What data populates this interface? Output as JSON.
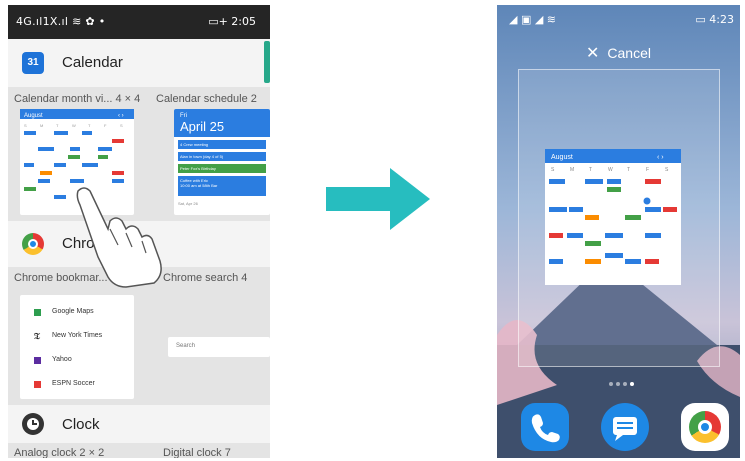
{
  "left_phone": {
    "status_bar": {
      "left": "4G.ıl1X.ıl ≋ ✿ •",
      "right": "▭+ 2:05"
    },
    "apps": [
      {
        "name": "Calendar",
        "icon": "calendar-icon",
        "icon_text": "31"
      },
      {
        "name": "Chrome",
        "icon": "chrome-icon"
      },
      {
        "name": "Clock",
        "icon": "clock-icon"
      }
    ],
    "calendar_widgets": [
      {
        "label": "Calendar month vi... 4 × 4"
      },
      {
        "label": "Calendar schedule  2"
      }
    ],
    "calendar_month_widget": {
      "month": "August"
    },
    "calendar_schedule_widget": {
      "day": "Fri",
      "date": "April 25",
      "events": [
        "4 Crew meeting",
        "Alan in town (day 4 of 5)",
        "Peter Fox's Birthday",
        "Coffee with Eric"
      ],
      "event_time": "10:00 am at 58th Bar",
      "footer": "Sat, Apr 26"
    },
    "chrome_widgets": [
      {
        "label": "Chrome bookmar... 3"
      },
      {
        "label": "Chrome search   4"
      }
    ],
    "bookmarks": [
      {
        "name": "Google Maps",
        "color": "#2e9e4f"
      },
      {
        "name": "New York Times",
        "color": "#222222"
      },
      {
        "name": "Yahoo",
        "color": "#5b2ca0"
      },
      {
        "name": "ESPN Soccer",
        "color": "#e53935"
      }
    ],
    "search_placeholder": "Search",
    "clock_widgets": [
      {
        "label": "Analog clock     2 × 2"
      },
      {
        "label": "Digital clock    7"
      }
    ]
  },
  "arrow_color": "#27bdbf",
  "right_phone": {
    "status_bar": {
      "left": "◢ ▣ ◢ ≋",
      "right": "▭ 4:23"
    },
    "cancel_label": "Cancel",
    "cancel_icon": "close-icon",
    "widget_month": "August",
    "page_dots": 4,
    "active_dot": 3,
    "dock": [
      {
        "name": "phone-icon",
        "color": "#1e88e5"
      },
      {
        "name": "messages-icon",
        "color": "#1e88e5"
      },
      {
        "name": "chrome-icon",
        "color": "#ffffff"
      }
    ]
  },
  "colors": {
    "accent_blue": "#1e88e5",
    "teal": "#27bdbf",
    "red": "#e53935",
    "green": "#43a047",
    "orange": "#fb8c00"
  }
}
